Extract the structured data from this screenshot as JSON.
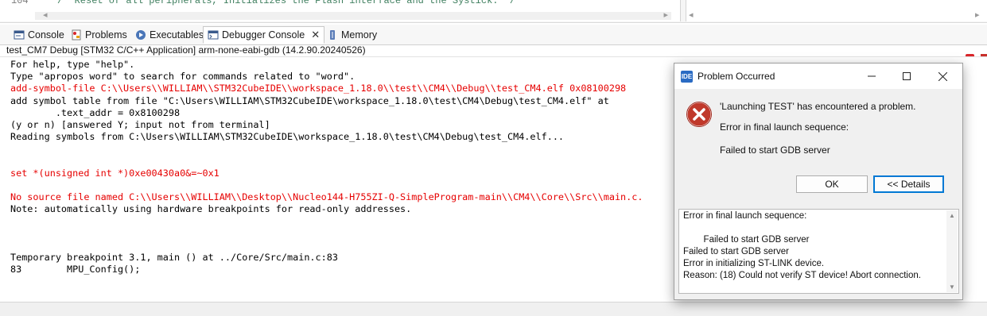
{
  "editor": {
    "line_number": "104",
    "code_comment": "/* Reset of all peripherals, Initializes the Flash interface and the Systick. */"
  },
  "tabs": [
    {
      "label": "Console",
      "icon": "console-icon"
    },
    {
      "label": "Problems",
      "icon": "problems-icon"
    },
    {
      "label": "Executables",
      "icon": "executables-icon"
    },
    {
      "label": "Debugger Console",
      "icon": "debugger-console-icon",
      "active": true
    },
    {
      "label": "Memory",
      "icon": "memory-icon"
    }
  ],
  "session_title": "test_CM7 Debug [STM32 C/C++ Application] arm-none-eabi-gdb (14.2.90.20240526)",
  "console": {
    "lines": [
      {
        "text": "For help, type \"help\".",
        "color": "black"
      },
      {
        "text": "Type \"apropos word\" to search for commands related to \"word\".",
        "color": "black"
      },
      {
        "text": "add-symbol-file C:\\\\Users\\\\WILLIAM\\\\STM32CubeIDE\\\\workspace_1.18.0\\\\test\\\\CM4\\\\Debug\\\\test_CM4.elf 0x08100298",
        "color": "red"
      },
      {
        "text": "add symbol table from file \"C:\\Users\\WILLIAM\\STM32CubeIDE\\workspace_1.18.0\\test\\CM4\\Debug\\test_CM4.elf\" at",
        "color": "black"
      },
      {
        "text": "        .text_addr = 0x8100298",
        "color": "black"
      },
      {
        "text": "(y or n) [answered Y; input not from terminal]",
        "color": "black"
      },
      {
        "text": "Reading symbols from C:\\Users\\WILLIAM\\STM32CubeIDE\\workspace_1.18.0\\test\\CM4\\Debug\\test_CM4.elf...",
        "color": "black"
      },
      {
        "text": "",
        "color": "black"
      },
      {
        "text": "",
        "color": "black"
      },
      {
        "text": "set *(unsigned int *)0xe00430a0&=~0x1",
        "color": "red"
      },
      {
        "text": "",
        "color": "black"
      },
      {
        "text": "No source file named C:\\\\Users\\\\WILLIAM\\\\Desktop\\\\Nucleo144-H755ZI-Q-SimpleProgram-main\\\\CM4\\\\Core\\\\Src\\\\main.c.",
        "color": "red"
      },
      {
        "text": "Note: automatically using hardware breakpoints for read-only addresses.",
        "color": "black"
      },
      {
        "text": "",
        "color": "black"
      },
      {
        "text": "",
        "color": "black"
      },
      {
        "text": "",
        "color": "black"
      },
      {
        "text": "Temporary breakpoint 3.1, main () at ../Core/Src/main.c:83",
        "color": "black"
      },
      {
        "text": "83        MPU_Config();",
        "color": "black"
      }
    ]
  },
  "dialog": {
    "title": "Problem Occurred",
    "logo_text": "IDE",
    "message": "'Launching TEST' has encountered a problem.",
    "reason": "Error in final launch sequence:",
    "detail": "Failed to start GDB server",
    "ok_label": "OK",
    "details_label": "<< Details",
    "details_lines": [
      "Error in final launch sequence:",
      "",
      "        Failed to start GDB server",
      "Failed to start GDB server",
      "Error in initializing ST-LINK device.",
      "Reason: (18) Could not verify ST device! Abort connection."
    ]
  },
  "colors": {
    "accent": "#0078d4",
    "error_red": "#e60000",
    "terminate_red": "#d9262b"
  }
}
